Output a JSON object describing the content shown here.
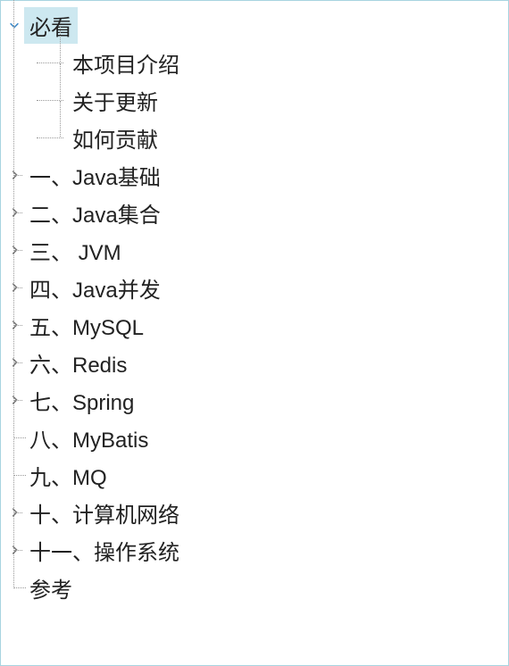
{
  "tree": {
    "root": {
      "label": "必看",
      "expanded": true,
      "selected": true,
      "children": [
        {
          "label": "本项目介绍"
        },
        {
          "label": "关于更新"
        },
        {
          "label": "如何贡献"
        }
      ]
    },
    "sections": [
      {
        "label": "一、Java基础",
        "expandable": true
      },
      {
        "label": "二、Java集合",
        "expandable": true
      },
      {
        "label": "三、 JVM",
        "expandable": true
      },
      {
        "label": "四、Java并发",
        "expandable": true
      },
      {
        "label": "五、MySQL",
        "expandable": true
      },
      {
        "label": "六、Redis",
        "expandable": true
      },
      {
        "label": "七、Spring",
        "expandable": true
      },
      {
        "label": "八、MyBatis",
        "expandable": false
      },
      {
        "label": "九、MQ",
        "expandable": false
      },
      {
        "label": "十、计算机网络",
        "expandable": true
      },
      {
        "label": "十一、操作系统",
        "expandable": true
      },
      {
        "label": "参考",
        "expandable": false
      }
    ]
  }
}
